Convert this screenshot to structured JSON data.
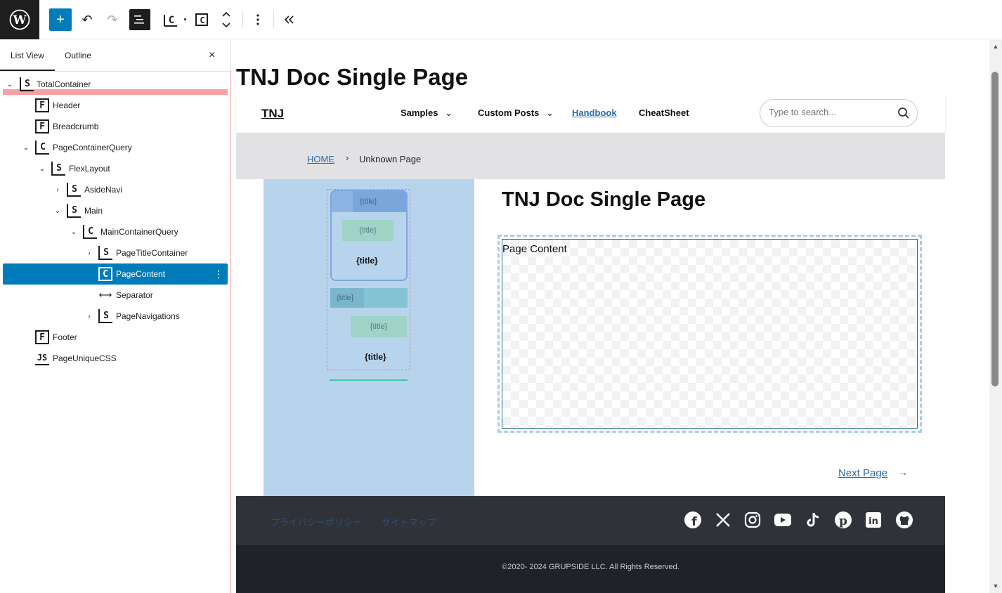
{
  "toolbar": {
    "add_label": "+",
    "undo_label": "↶",
    "redo_label": "↷"
  },
  "sidebar": {
    "tabs": [
      {
        "label": "List View"
      },
      {
        "label": "Outline"
      }
    ],
    "close_label": "×",
    "tree": [
      {
        "label": "TotalContainer",
        "icon": "S",
        "chevron": "⌄"
      },
      {
        "label": "Header",
        "icon": "F",
        "chevron": ""
      },
      {
        "label": "Breadcrumb",
        "icon": "F",
        "chevron": ""
      },
      {
        "label": "PageContainerQuery",
        "icon": "C",
        "chevron": "⌄"
      },
      {
        "label": "FlexLayout",
        "icon": "S",
        "chevron": "⌄"
      },
      {
        "label": "AsideNavi",
        "icon": "S",
        "chevron": "›"
      },
      {
        "label": "Main",
        "icon": "S",
        "chevron": "⌄"
      },
      {
        "label": "MainContainerQuery",
        "icon": "C",
        "chevron": "⌄"
      },
      {
        "label": "PageTitleContainer",
        "icon": "S",
        "chevron": "›"
      },
      {
        "label": "PageContent",
        "icon": "C",
        "chevron": ""
      },
      {
        "label": "Separator",
        "icon": "⟷",
        "chevron": ""
      },
      {
        "label": "PageNavigations",
        "icon": "S",
        "chevron": "›"
      },
      {
        "label": "Footer",
        "icon": "F",
        "chevron": ""
      },
      {
        "label": "PageUniqueCSS",
        "icon": "JS",
        "chevron": ""
      }
    ],
    "row_options_label": "⋮"
  },
  "page": {
    "title": "TNJ Doc Single Page",
    "header": {
      "brand": "TNJ",
      "nav": [
        {
          "label": "Samples",
          "has_dropdown": true
        },
        {
          "label": "Custom Posts",
          "has_dropdown": true
        },
        {
          "label": "Handbook",
          "has_dropdown": false
        },
        {
          "label": "CheatSheet",
          "has_dropdown": false
        }
      ],
      "search_placeholder": "Type to search..."
    },
    "breadcrumb": {
      "home": "HOME",
      "separator": "›",
      "current": "Unknown Page"
    },
    "aside": {
      "card1_header": "{title}",
      "card1_chip": "{title}",
      "card1_bold": "{title}",
      "card2_header": "{title}",
      "card2_chip": "{title}",
      "card2_bold": "{title}"
    },
    "main": {
      "title": "TNJ Doc Single Page",
      "content_label": "Page Content",
      "next_page": "Next Page",
      "next_arrow": "→"
    },
    "footer": {
      "links": [
        "プライバシーポリシー",
        "サイトマップ"
      ],
      "social": [
        "facebook-icon",
        "x-icon",
        "instagram-icon",
        "youtube-icon",
        "tiktok-icon",
        "pinterest-icon",
        "linkedin-icon",
        "github-icon"
      ],
      "copyright": "©2020- 2024 GRUPSIDE LLC. All Rights Reserved."
    }
  },
  "colors": {
    "accent": "#007cba",
    "link": "#2a6ba8",
    "footer_top": "#2f3339",
    "footer_bottom": "#1f2328",
    "aside_bg": "#b7d4ec"
  }
}
